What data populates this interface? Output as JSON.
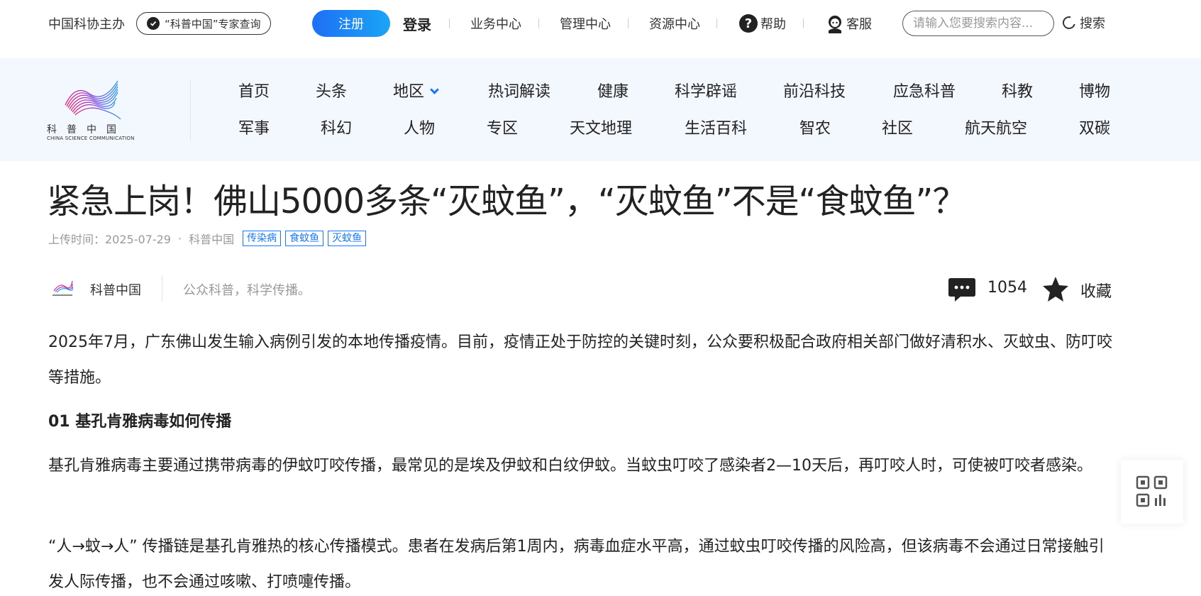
{
  "topbar": {
    "org": "中国科协主办",
    "expert_query": "“科普中国”专家查询",
    "register": "注册",
    "login": "登录",
    "links": [
      "业务中心",
      "管理中心",
      "资源中心"
    ],
    "help": "帮助",
    "service": "客服",
    "search_placeholder": "请输入您要搜索内容...",
    "search": "搜索"
  },
  "logo": {
    "cn": "科普中国",
    "en": "CHINA SCIENCE COMMUNICATION"
  },
  "nav": {
    "row1": [
      "首页",
      "头条",
      "地区",
      "热词解读",
      "健康",
      "科学辟谣",
      "前沿科技",
      "应急科普",
      "科教",
      "博物"
    ],
    "row2": [
      "军事",
      "科幻",
      "人物",
      "专区",
      "天文地理",
      "生活百科",
      "智农",
      "社区",
      "航天航空",
      "双碳"
    ]
  },
  "article": {
    "title": "紧急上岗！佛山5000多条“灭蚊鱼”，“灭蚊鱼”不是“食蚊鱼”？",
    "upload_label": "上传时间：2025-07-29",
    "dot": "·",
    "source": "科普中国",
    "tags": [
      "传染病",
      "食蚊鱼",
      "灭蚊鱼"
    ],
    "author": "科普中国",
    "slogan": "公众科普，科学传播。",
    "comments": "1054",
    "collect": "收藏",
    "p1": "2025年7月，广东佛山发生输入病例引发的本地传播疫情。目前，疫情正处于防控的关键时刻，公众要积极配合政府相关部门做好清积水、灭蚊虫、防叮咬等措施。",
    "h1": "01 基孔肯雅病毒如何传播",
    "p2": "基孔肯雅病毒主要通过携带病毒的伊蚊叮咬传播，最常见的是埃及伊蚊和白纹伊蚊。当蚊虫叮咬了感染者2—10天后，再叮咬人时，可使被叮咬者感染。",
    "p3": "“人→蚊→人” 传播链是基孔肯雅热的核心传播模式。患者在发病后第1周内，病毒血症水平高，通过蚊虫叮咬传播的风险高，但该病毒不会通过日常接触引发人际传播，也不会通过咳嗽、打喷嚏传播。"
  },
  "colors": {
    "accent": "#1677ff",
    "nav_bg": "#f3f7fe"
  }
}
